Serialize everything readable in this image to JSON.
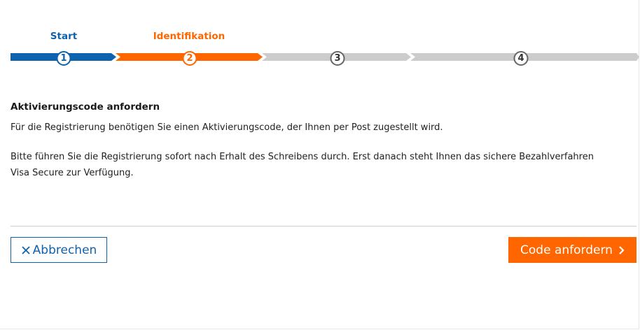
{
  "steps": [
    {
      "label": "Start",
      "number": "1",
      "color": "#0f62ad"
    },
    {
      "label": "Identifikation",
      "number": "2",
      "color": "#ff6600"
    },
    {
      "label": "",
      "number": "3",
      "color": "#cccccc"
    },
    {
      "label": "",
      "number": "4",
      "color": "#cccccc"
    }
  ],
  "content": {
    "title": "Aktivierungscode anfordern",
    "paragraph1": "Für die Registrierung benötigen Sie einen Aktivierungscode, der Ihnen per Post zugestellt wird.",
    "paragraph2": "Bitte führen Sie die Registrierung sofort nach Erhalt des Schreibens durch. Erst danach steht Ihnen das sichere Bezahlverfahren Visa Secure zur Verfügung."
  },
  "actions": {
    "cancel_label": "Abbrechen",
    "submit_label": "Code anfordern"
  },
  "colors": {
    "primary_blue": "#0f62ad",
    "accent_orange": "#ff6600",
    "inactive_gray": "#cccccc"
  }
}
